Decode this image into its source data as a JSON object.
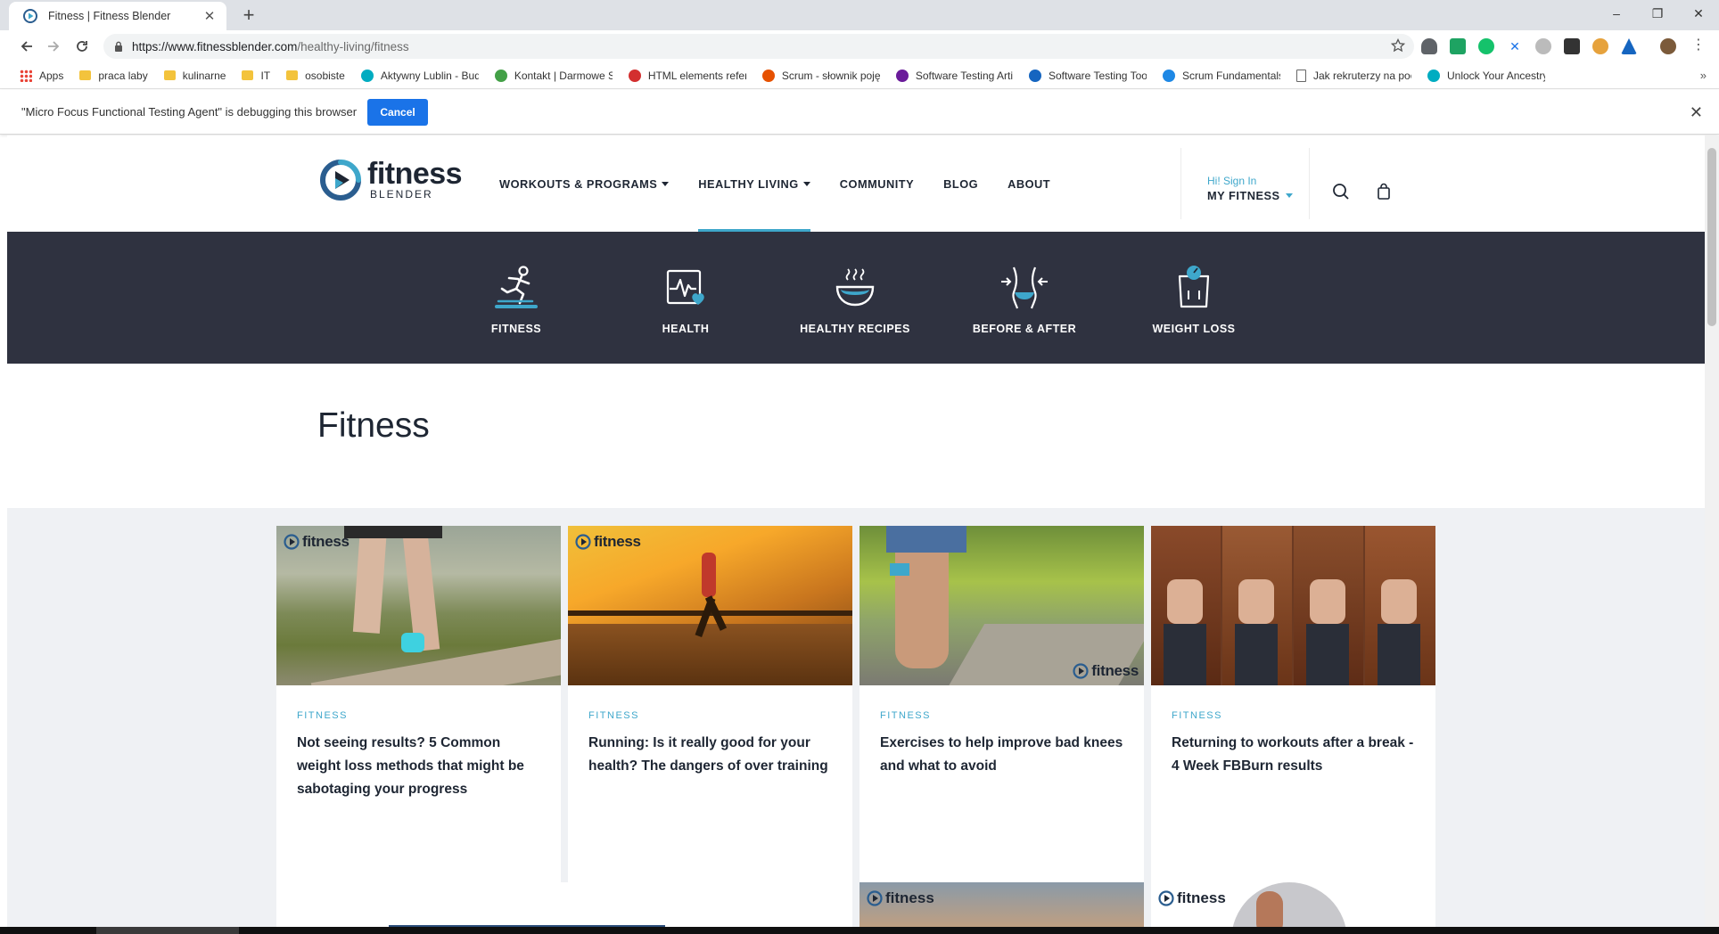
{
  "browser": {
    "tab_title": "Fitness | Fitness Blender",
    "tab_close": "✕",
    "new_tab": "+",
    "url_host": "https://www.fitnessblender.com",
    "url_path": "/healthy-living/fitness",
    "window_controls": [
      "–",
      "❐",
      "✕"
    ],
    "bookmarks": [
      {
        "label": "Apps",
        "icon": "apps-grid-icon"
      },
      {
        "label": "praca laby",
        "icon": "folder-icon"
      },
      {
        "label": "kulinarne",
        "icon": "folder-icon"
      },
      {
        "label": "IT",
        "icon": "folder-icon"
      },
      {
        "label": "osobiste",
        "icon": "folder-icon"
      },
      {
        "label": "Aktywny Lublin - Bud",
        "icon": "site-icon"
      },
      {
        "label": "Kontakt | Darmowe S",
        "icon": "site-icon"
      },
      {
        "label": "HTML elements refer",
        "icon": "site-icon"
      },
      {
        "label": "Scrum - słownik poję",
        "icon": "site-icon"
      },
      {
        "label": "Software Testing Arti",
        "icon": "site-icon"
      },
      {
        "label": "Software Testing Too",
        "icon": "site-icon"
      },
      {
        "label": "Scrum Fundamentals",
        "icon": "site-icon"
      },
      {
        "label": "Jak rekruterzy na poc",
        "icon": "page-icon"
      },
      {
        "label": "Unlock Your Ancestry",
        "icon": "site-icon"
      }
    ],
    "bookmarks_more": "»",
    "infobar_message": "\"Micro Focus Functional Testing Agent\" is debugging this browser",
    "infobar_cancel": "Cancel",
    "infobar_close": "✕"
  },
  "site": {
    "logo_main": "fitness",
    "logo_sub": "BLENDER",
    "nav": [
      {
        "label": "WORKOUTS & PROGRAMS",
        "dropdown": true,
        "active": false
      },
      {
        "label": "HEALTHY LIVING",
        "dropdown": true,
        "active": true
      },
      {
        "label": "COMMUNITY",
        "dropdown": false,
        "active": false
      },
      {
        "label": "BLOG",
        "dropdown": false,
        "active": false
      },
      {
        "label": "ABOUT",
        "dropdown": false,
        "active": false
      }
    ],
    "account_greeting": "Hi! Sign In",
    "account_label": "MY FITNESS",
    "accent_color": "#3ea7cb",
    "dark_color": "#2f3240"
  },
  "categories": [
    {
      "label": "FITNESS",
      "icon": "runner-icon"
    },
    {
      "label": "HEALTH",
      "icon": "heartbeat-icon"
    },
    {
      "label": "HEALTHY RECIPES",
      "icon": "bowl-icon"
    },
    {
      "label": "BEFORE & AFTER",
      "icon": "waist-icon"
    },
    {
      "label": "WEIGHT LOSS",
      "icon": "scale-icon"
    }
  ],
  "page_title": "Fitness",
  "watermark": "fitness",
  "articles": [
    {
      "category": "FITNESS",
      "title": "Not seeing results? 5 Common weight loss methods that might be sabotaging your progress"
    },
    {
      "category": "FITNESS",
      "title": "Running: Is it really good for your health? The dangers of over training"
    },
    {
      "category": "FITNESS",
      "title": "Exercises to help improve bad knees and what to avoid"
    },
    {
      "category": "FITNESS",
      "title": "Returning to workouts after a break - 4 Week FBBurn results"
    }
  ]
}
